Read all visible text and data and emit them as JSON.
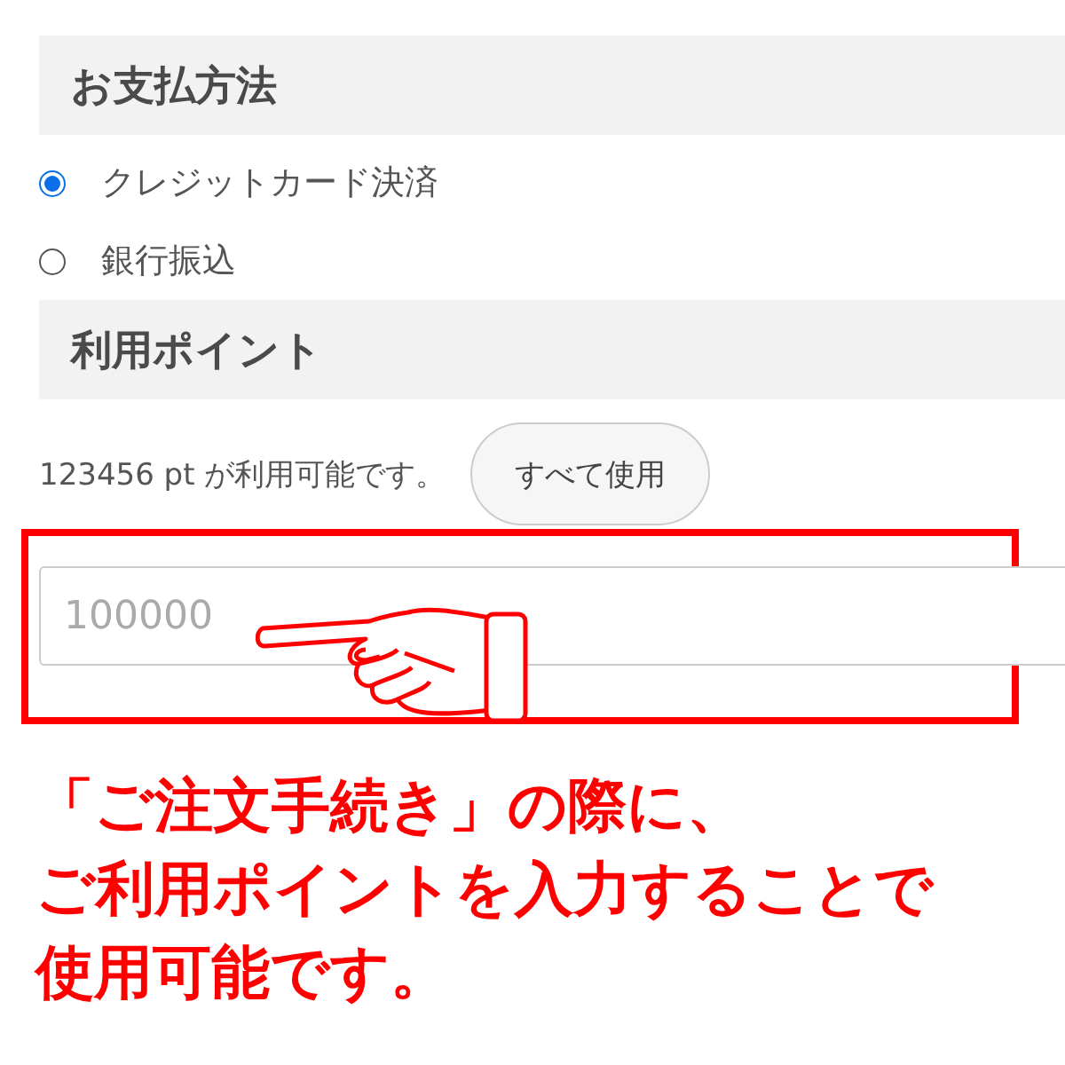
{
  "payment": {
    "heading": "お支払方法",
    "options": [
      {
        "label": "クレジットカード決済",
        "selected": true
      },
      {
        "label": "銀行振込",
        "selected": false
      }
    ]
  },
  "points": {
    "heading": "利用ポイント",
    "available": "123456 pt が利用可能です。",
    "button": "すべて使用",
    "input": {
      "placeholder": "100000"
    }
  },
  "annotation": {
    "lines": [
      "「ご注文手続き」の際に、",
      "ご利用ポイントを入力することで",
      "使用可能です。"
    ]
  }
}
